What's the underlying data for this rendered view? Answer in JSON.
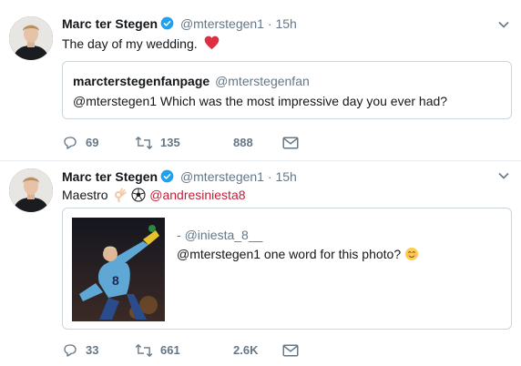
{
  "tweets": [
    {
      "author_name": "Marc ter Stegen",
      "handle": "@mterstegen1",
      "dot": "·",
      "time": "15h",
      "text": "The day of my wedding.",
      "quote": {
        "author_name": "marcterstegenfanpage",
        "handle": "@mterstegenfan",
        "text": "@mterstegen1 Which was the most impressive day you ever had?"
      },
      "replies": "69",
      "retweets": "135",
      "likes": "888"
    },
    {
      "author_name": "Marc ter Stegen",
      "handle": "@mterstegen1",
      "dot": "·",
      "time": "15h",
      "text_prefix": "Maestro",
      "mention": "@andresiniesta8",
      "quote": {
        "dash": "-",
        "handle": "@iniesta_8__",
        "text": "@mterstegen1 one word for this photo?"
      },
      "replies": "33",
      "retweets": "661",
      "likes": "2.6K"
    }
  ],
  "colors": {
    "verified": "#1da1f2",
    "heart": "#e0245e",
    "mention": "#c11f3a",
    "muted": "#657786",
    "border": "#ccd6dd"
  },
  "icons": [
    "verified-badge-icon",
    "heart-emoji-icon",
    "caret-down-icon",
    "reply-icon",
    "retweet-icon",
    "mail-icon",
    "ok-hand-emoji-icon",
    "soccer-ball-emoji-icon",
    "smiling-face-emoji-icon"
  ]
}
